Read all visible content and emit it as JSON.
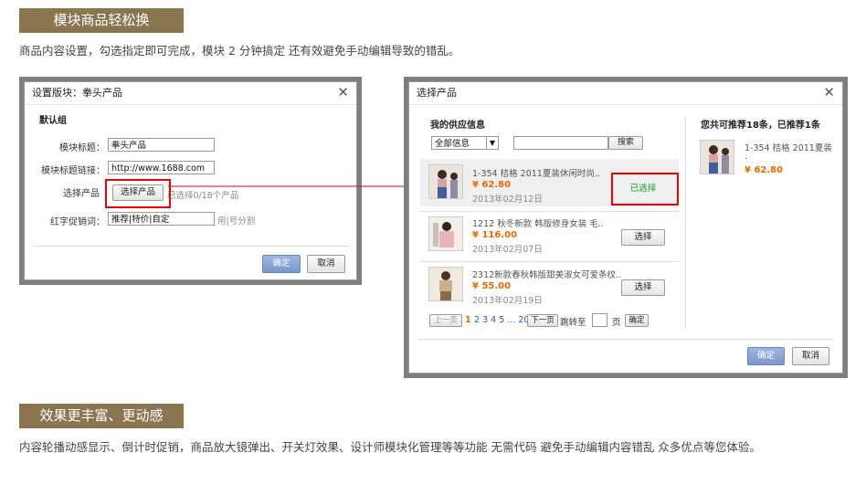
{
  "section1": {
    "title": "模块商品轻松换",
    "description": "商品内容设置，勾选指定即可完成，模块 2 分钟搞定  还有效避免手动编辑导致的错乱。"
  },
  "dialog1": {
    "title": "设置版块：拳头产品",
    "group_label": "默认组",
    "fields": {
      "module_title_label": "模块标题：",
      "module_title_value": "拳头产品",
      "module_link_label": "模块标题链接：",
      "module_link_value": "http://www.1688.com",
      "select_product_label": "选择产品",
      "select_product_button": "选择产品",
      "selected_count": "已选择0/18个产品",
      "promo_label": "红字促销词：",
      "promo_value": "推荐|特价|自定",
      "promo_hint": "用|号分割"
    },
    "ok": "确定",
    "cancel": "取消"
  },
  "dialog2": {
    "title": "选择产品",
    "left_heading": "我的供应信息",
    "filter_value": "全部信息",
    "search_button": "搜索",
    "products": [
      {
        "name": "1-354 桔格 2011夏装休闲时尚..",
        "price": "¥ 62.80",
        "date": "2013年02月12日",
        "action": "已选择"
      },
      {
        "name": "1212 秋冬新款 韩版修身女装 毛..",
        "price": "¥ 116.00",
        "date": "2013年02月07日",
        "action": "选择"
      },
      {
        "name": "2312新款春秋韩版甜美淑女可爱条纹..",
        "price": "¥ 55.00",
        "date": "2013年02月19日",
        "action": "选择"
      }
    ],
    "pagination": {
      "prev": "上一页",
      "current": "1",
      "pages": "2 3 4 5 ... 20",
      "next": "下一页",
      "jump_label": "跳转至",
      "page_unit": "页",
      "confirm": "确定"
    },
    "right_heading": "您共可推荐18条，已推荐1条",
    "recommended": {
      "name": "1-354 桔格 2011夏装",
      "dot": ".",
      "price": "¥ 62.80"
    },
    "ok": "确定",
    "cancel": "取消"
  },
  "section2": {
    "title": "效果更丰富、更动感",
    "description": "内容轮播动感显示、倒计时促销，商品放大镜弹出、开关灯效果、设计师模块化管理等等功能  无需代码  避免手动编辑内容错乱  众多优点等您体验。"
  },
  "colors": {
    "accent_bar": "#8b7550",
    "price": "#e36b00",
    "highlight": "#e00000",
    "selected_text": "#1a9a1a",
    "page_link": "#2a5db0"
  }
}
